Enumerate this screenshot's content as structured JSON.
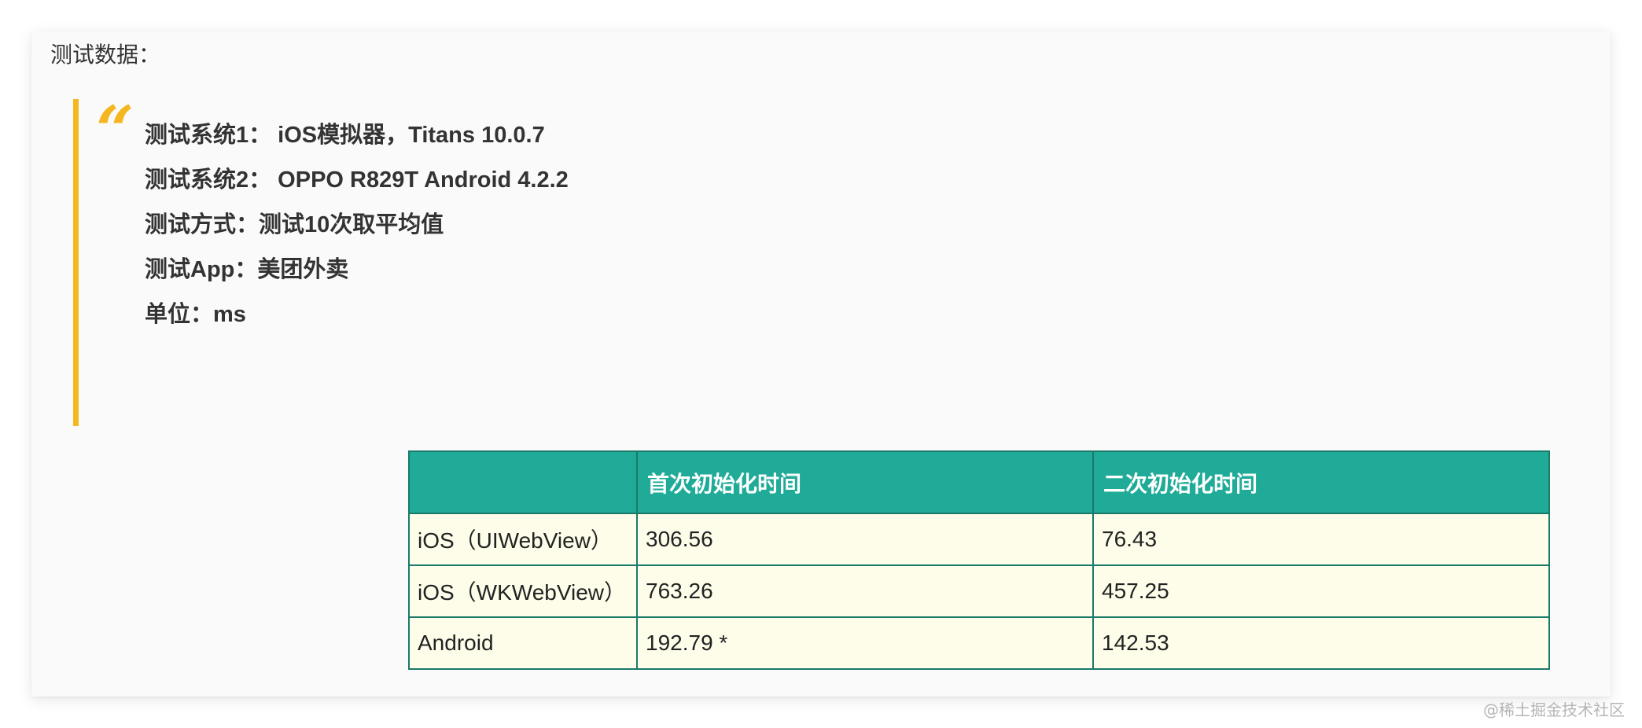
{
  "heading": "测试数据：",
  "quote": {
    "lines": [
      "测试系统1： iOS模拟器，Titans 10.0.7",
      "测试系统2： OPPO R829T Android 4.2.2",
      "测试方式：测试10次取平均值",
      "测试App：美团外卖",
      "单位：ms"
    ]
  },
  "table": {
    "headers": [
      "",
      "首次初始化时间",
      "二次初始化时间"
    ],
    "rows": [
      [
        "iOS（UIWebView）",
        "306.56",
        "76.43"
      ],
      [
        "iOS（WKWebView）",
        "763.26",
        "457.25"
      ],
      [
        "Android",
        "192.79 *",
        "142.53"
      ]
    ]
  },
  "watermark": "@稀土掘金技术社区",
  "colors": {
    "accent": "#f4b71f",
    "table_header": "#1fab98",
    "table_border": "#1a7a6a",
    "table_cell": "#fdfdea"
  }
}
